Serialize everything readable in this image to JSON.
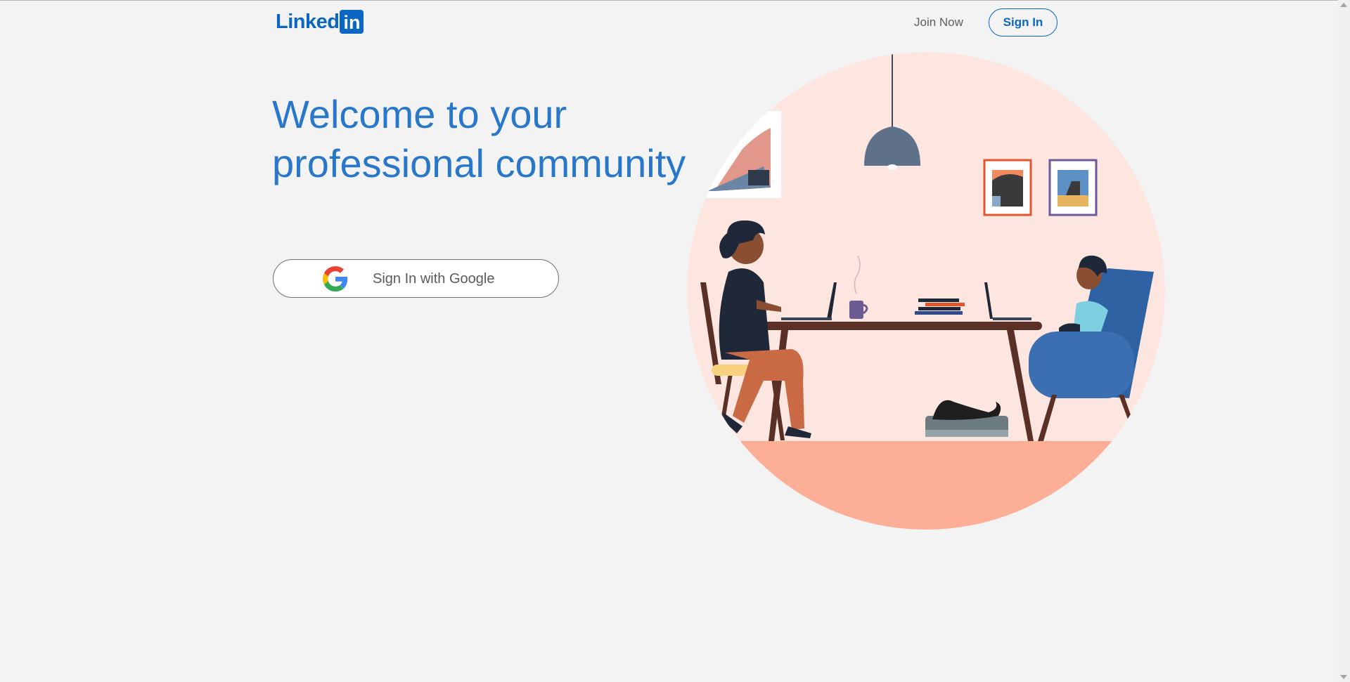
{
  "header": {
    "logo_text": "Linked",
    "logo_box_text": "in",
    "join_label": "Join Now",
    "signin_label": "Sign In"
  },
  "hero": {
    "headline_line1": "Welcome to your",
    "headline_line2": "professional community",
    "google_button_label": "Sign In with Google"
  },
  "icons": {
    "google": "google-g-logo",
    "up": "scroll-up-arrow",
    "down": "scroll-down-arrow"
  },
  "colors": {
    "brand": "#0a66c2",
    "headline": "#2977c9",
    "background": "#f3f3f3",
    "circle": "#fde6e0",
    "floor": "#fcae97"
  }
}
